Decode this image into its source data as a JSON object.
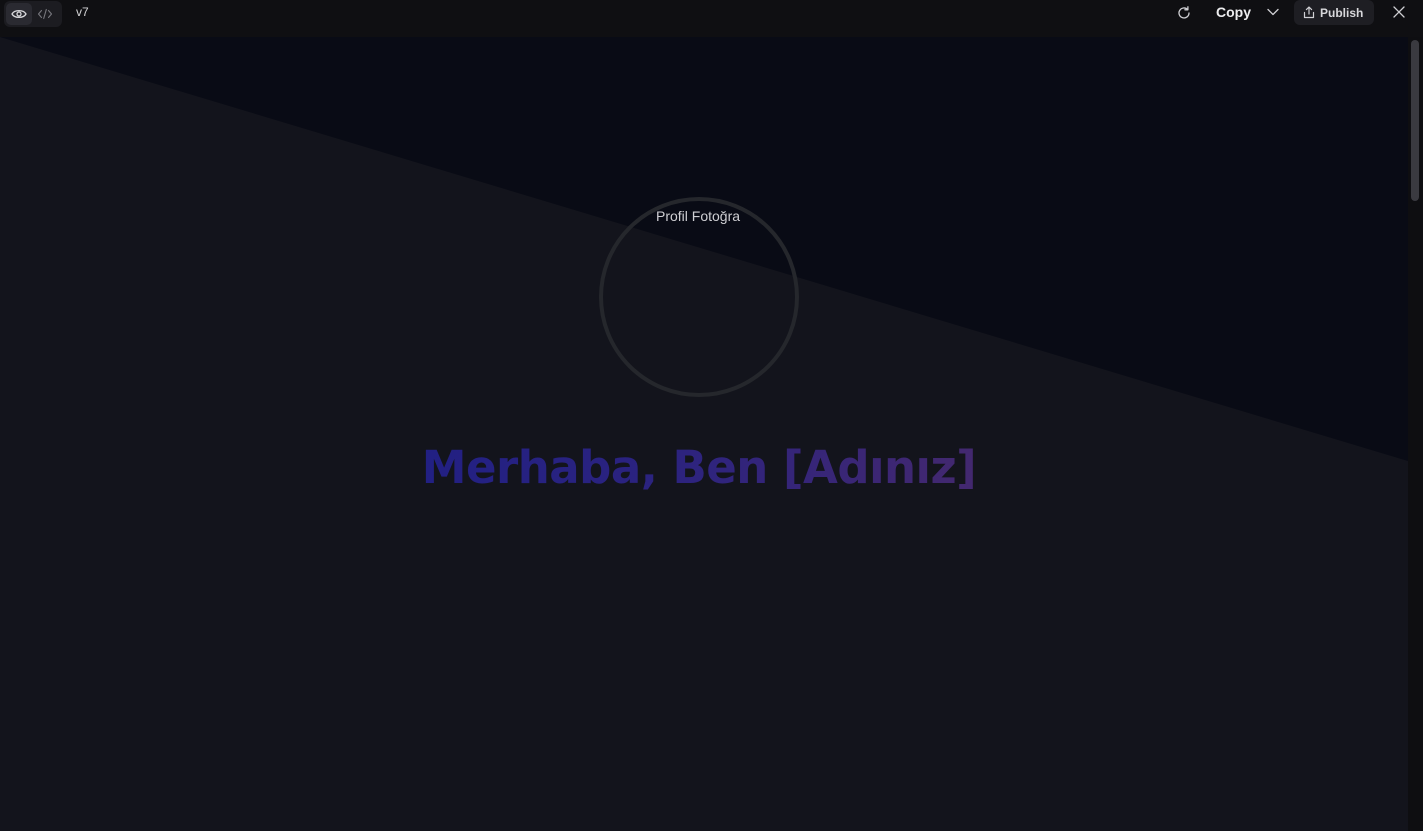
{
  "toolbar": {
    "preview_icon": "eye-icon",
    "code_icon": "code-icon",
    "version": "v7",
    "refresh_icon": "refresh-icon",
    "copy_label": "Copy",
    "copy_menu_icon": "chevron-down-icon",
    "publish_icon": "share-upload-icon",
    "publish_label": "Publish",
    "close_icon": "close-icon"
  },
  "preview": {
    "profile_image_alt": "Profil Fotoğrafı",
    "profile_label_visible": "Profil Fotoğra",
    "hero_title": "Merhaba, Ben [Adınız]",
    "colors": {
      "background_dark": "#090b15",
      "background_light": "#13141c",
      "title_gradient_start": "#222083",
      "title_gradient_end": "#43286f"
    }
  }
}
